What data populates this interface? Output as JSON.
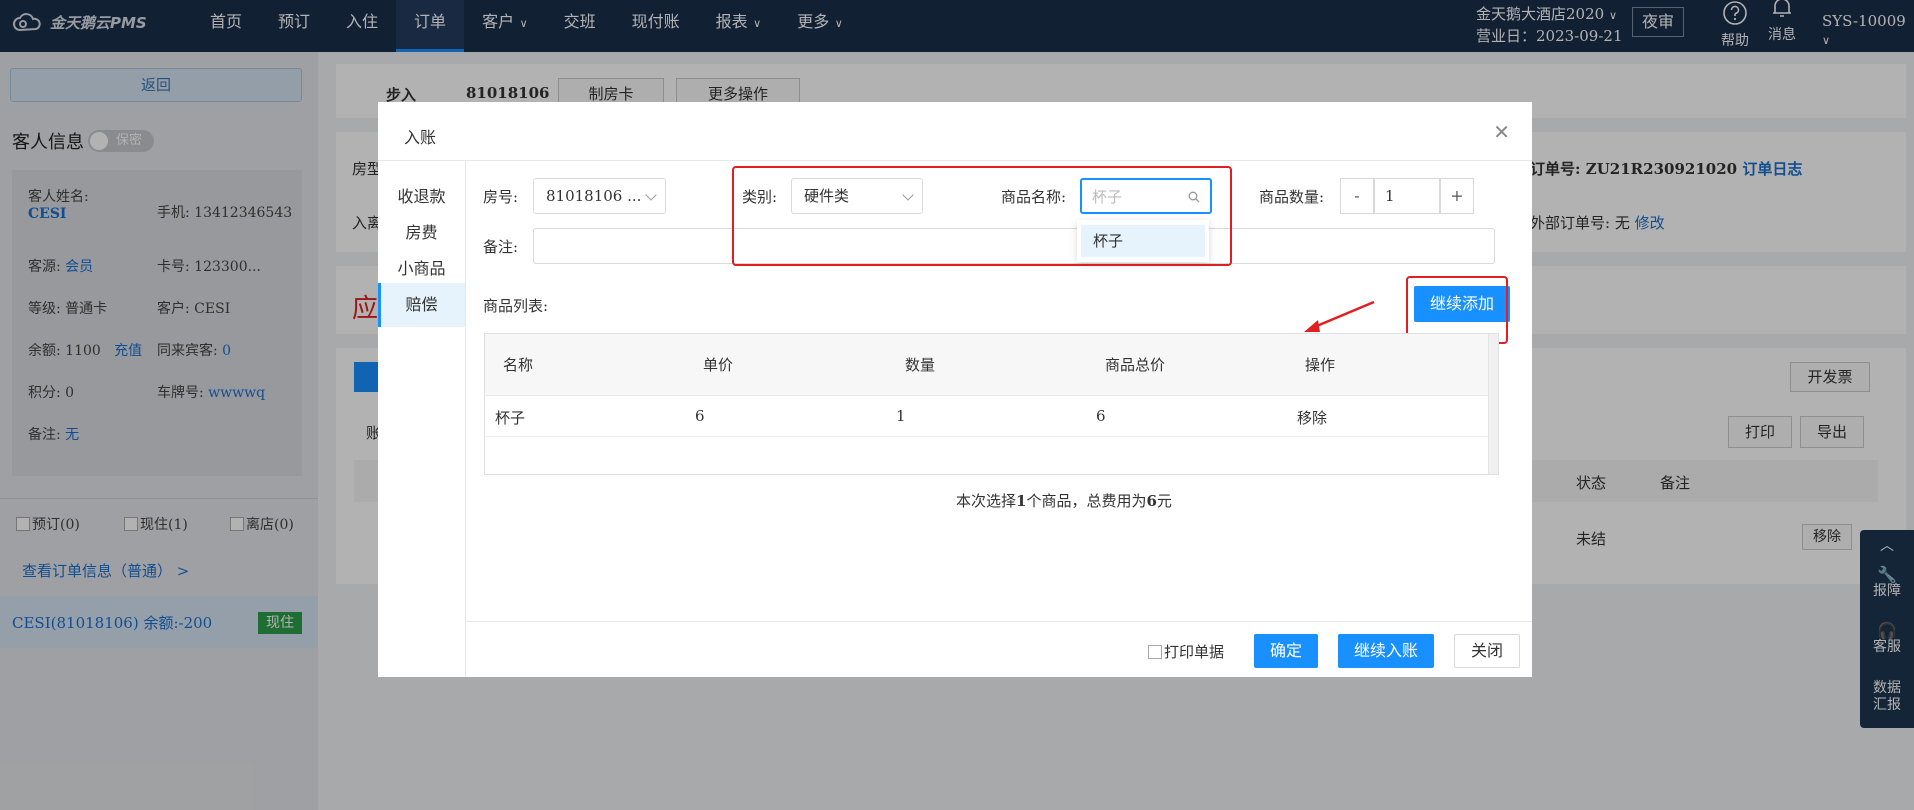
{
  "app": {
    "logo_text": "金天鹅云PMS"
  },
  "nav": [
    "首页",
    "预订",
    "入住",
    "订单",
    "客户",
    "交班",
    "现付账",
    "报表",
    "更多"
  ],
  "nav_caret": [
    false,
    false,
    false,
    false,
    true,
    false,
    false,
    true,
    true
  ],
  "nav_active": 3,
  "header": {
    "hotel_name": "金天鹅大酒店2020",
    "business_day": "营业日：2023-09-21",
    "night_audit": "夜审",
    "help": "帮助",
    "message": "消息",
    "user": "SYS-10009"
  },
  "left": {
    "back": "返回",
    "guest_info": "客人信息",
    "privacy": "保密",
    "name_label": "客人姓名:",
    "name_value": "CESI",
    "phone": "手机: 13412346543",
    "source_label": "客源:",
    "source_value": "会员",
    "card": "卡号: 123300...",
    "level": "等级: 普通卡",
    "customer": "客户: CESI",
    "balance": "余额: 1100",
    "recharge": "充值",
    "companions_label": "同来宾客:",
    "companions_value": "0",
    "points": "积分: 0",
    "plate_label": "车牌号:",
    "plate_value": "wwwwq",
    "remark_label": "备注:",
    "remark_value": "无",
    "filter_booked": "预订(0)",
    "filter_current": "现住(1)",
    "filter_left": "离店(0)",
    "order_link": "查看订单信息（普通）  >",
    "guest_row": "CESI(81018106)   余额:-200",
    "status": "现住"
  },
  "background": {
    "step": "步入",
    "room": "81018106",
    "make_card": "制房卡",
    "more_ops": "更多操作",
    "room_type": "房型",
    "checkin": "入离",
    "order_no_label": "订单号:",
    "order_no": "ZU21R230921020",
    "order_log": "订单日志",
    "ext_order_label": "外部订单号:",
    "ext_order_value": "无",
    "modify": "修改",
    "due": "应",
    "invoice": "开发票",
    "bill": "账",
    "print": "打印",
    "export": "导出",
    "col_status": "状态",
    "col_remark": "备注",
    "row_status": "未结",
    "row_remove": "移除"
  },
  "rightfloat": {
    "report": "报障",
    "service": "客服",
    "data": "数据汇报"
  },
  "modal": {
    "title": "入账",
    "tabs": [
      "收退款",
      "房费",
      "小商品",
      "赔偿"
    ],
    "active_tab": 3,
    "room_label": "房号:",
    "room_value": "81018106 ...",
    "category_label": "类别:",
    "category_value": "硬件类",
    "product_label": "商品名称:",
    "product_placeholder": "杯子",
    "qty_label": "商品数量:",
    "qty_minus": "-",
    "qty_value": "1",
    "qty_plus": "+",
    "remark_label": "备注:",
    "dropdown_options": [
      "杯子"
    ],
    "list_label": "商品列表:",
    "add_more": "继续添加",
    "columns": [
      "名称",
      "单价",
      "数量",
      "商品总价",
      "操作"
    ],
    "rows": [
      {
        "name": "杯子",
        "price": "6",
        "qty": "1",
        "total": "6",
        "action": "移除"
      }
    ],
    "summary_prefix": "本次选择",
    "summary_count": "1",
    "summary_mid": "个商品，总费用为",
    "summary_total": "6",
    "summary_suffix": "元",
    "print_receipt": "打印单据",
    "confirm": "确定",
    "continue_post": "继续入账",
    "close": "关闭"
  },
  "colors": {
    "primary": "#1890ff",
    "nav_bg": "#1b2f4b",
    "annotation_red": "#e02020",
    "status_green": "#2b9c49"
  }
}
